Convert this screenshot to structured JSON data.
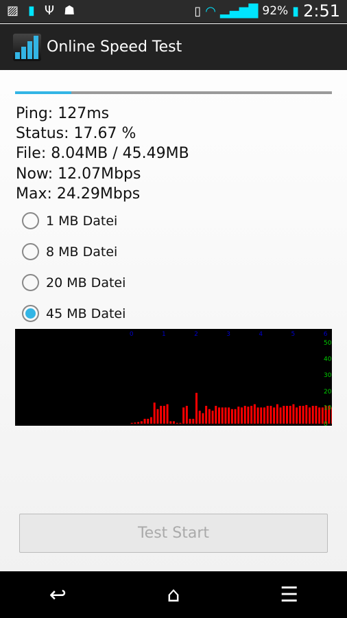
{
  "status_bar": {
    "icons": [
      "gallery-icon",
      "usb-battery-icon",
      "usb-icon",
      "android-debug-icon",
      "vibrate-icon",
      "wifi-icon",
      "signal-icon",
      "battery-charging-icon"
    ],
    "battery": "92%",
    "time": "2:51"
  },
  "app": {
    "title": "Online Speed Test"
  },
  "progress": {
    "percent": 17.67,
    "color": "#33b5e5"
  },
  "info": {
    "ping": "Ping: 127ms",
    "status": "Status: 17.67 %",
    "file": "File: 8.04MB / 45.49MB",
    "now": "Now: 12.07Mbps",
    "max": "Max: 24.29Mbps"
  },
  "options": [
    {
      "label": "1 MB Datei",
      "selected": false
    },
    {
      "label": "8 MB Datei",
      "selected": false
    },
    {
      "label": "20 MB Datei",
      "selected": false
    },
    {
      "label": "45 MB Datei",
      "selected": true
    }
  ],
  "chart_data": {
    "type": "bar",
    "x_ticks": [
      "0",
      "1",
      "2",
      "3",
      "4",
      "5",
      "6"
    ],
    "y_ticks": [
      "0",
      "10",
      "20",
      "30",
      "40",
      "50"
    ],
    "ylim": [
      0,
      50
    ],
    "xlim": [
      -3.6,
      6.2
    ],
    "x_step": 0.1,
    "bar_color": "#ff0000",
    "x_tick_color": "#0000cc",
    "y_tick_color": "#00cc00",
    "background": "#000000",
    "values": [
      0.5,
      0.7,
      1,
      1.5,
      3,
      3,
      4,
      13,
      9,
      11,
      11,
      12,
      1.5,
      1.5,
      0.5,
      0.5,
      10,
      11,
      3,
      3,
      19,
      8,
      6.5,
      11,
      9,
      8,
      11,
      10,
      10,
      10,
      10,
      9,
      9,
      10.5,
      10,
      11,
      10.5,
      11,
      12,
      10,
      10,
      10,
      11,
      11,
      10,
      12,
      10,
      11,
      11,
      11,
      12,
      10,
      11,
      11,
      11.5,
      10,
      11,
      11,
      10,
      10,
      11,
      11,
      10
    ]
  },
  "button": {
    "label": "Test Start"
  },
  "nav": {
    "back": "back-icon",
    "home": "home-icon",
    "menu": "menu-icon"
  }
}
